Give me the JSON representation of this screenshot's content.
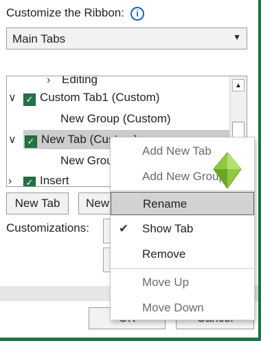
{
  "header": {
    "title": "Customize the Ribbon:",
    "info_icon": "i"
  },
  "select": {
    "value": "Main Tabs",
    "arrow": "▼"
  },
  "tree": {
    "items": [
      {
        "chevron": "›",
        "label": "Editing",
        "checked": false
      },
      {
        "chevron": "∨",
        "label": "Custom Tab1 (Custom)",
        "checked": true
      },
      {
        "chevron": "",
        "label": "New Group (Custom)",
        "checked": false
      },
      {
        "chevron": "∨",
        "label": "New Tab (Custom)",
        "checked": true
      },
      {
        "chevron": "",
        "label": "New Group",
        "checked": false
      },
      {
        "chevron": "›",
        "label": "Insert",
        "checked": true
      }
    ]
  },
  "buttons": {
    "new_tab": "New Tab",
    "new_group": "New",
    "ok": "OK",
    "cancel": "Cancel"
  },
  "customizations_label": "Customizations:",
  "context_menu": {
    "items": [
      {
        "label": "Add New Tab",
        "mnemonic": "N"
      },
      {
        "label": "Add New Group",
        "mnemonic": "N"
      },
      {
        "label": "Rename",
        "mnemonic": "m"
      },
      {
        "label": "Show Tab",
        "mnemonic": "h",
        "checked": true
      },
      {
        "label": "Remove",
        "mnemonic": "R"
      },
      {
        "label": "Move Up",
        "mnemonic": "U"
      },
      {
        "label": "Move Down",
        "mnemonic": "D"
      }
    ]
  },
  "colors": {
    "accent": "#217346",
    "highlight": "#d2d2d2",
    "info_blue": "#1f5fb4"
  }
}
